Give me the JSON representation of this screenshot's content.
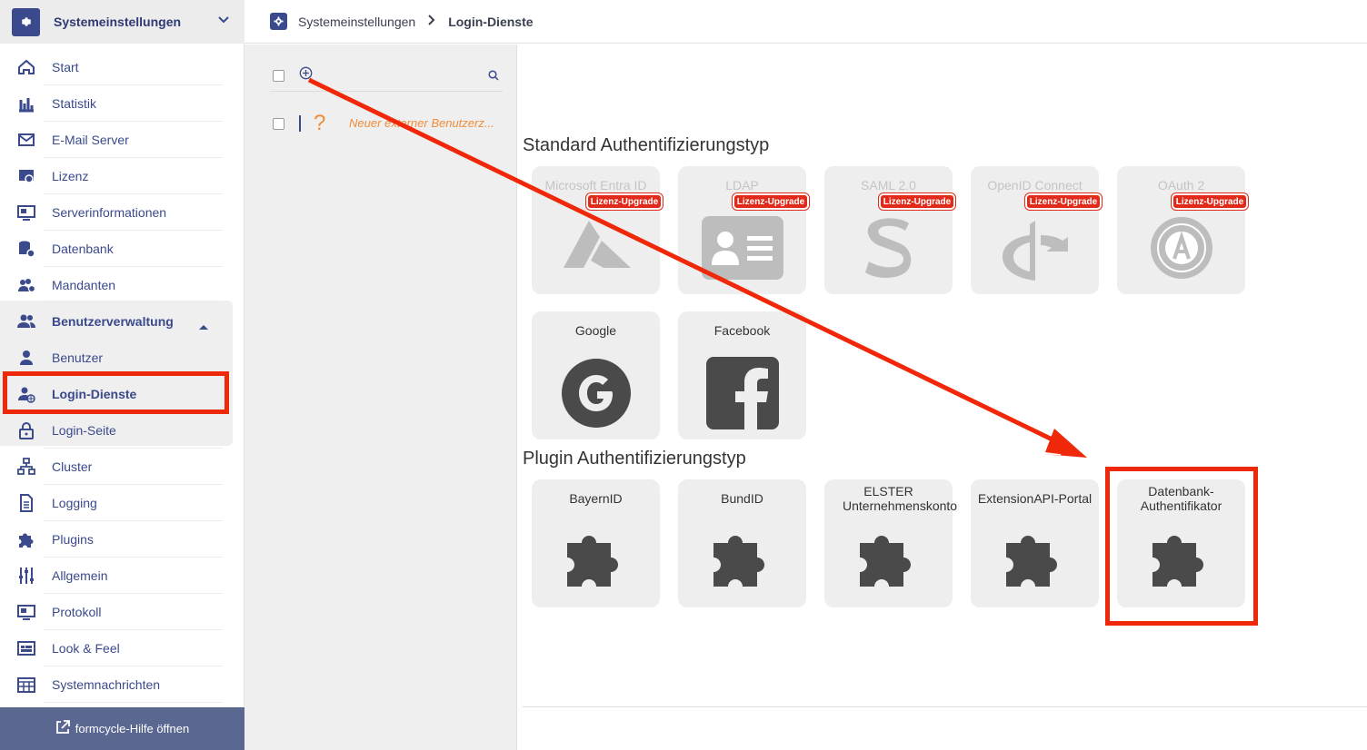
{
  "sidebar": {
    "header_title": "Systemeinstellungen",
    "items": [
      {
        "label": "Start",
        "icon": "home-icon"
      },
      {
        "label": "Statistik",
        "icon": "chart-icon"
      },
      {
        "label": "E-Mail Server",
        "icon": "mail-icon"
      },
      {
        "label": "Lizenz",
        "icon": "license-icon"
      },
      {
        "label": "Serverinformationen",
        "icon": "server-icon"
      },
      {
        "label": "Datenbank",
        "icon": "database-icon"
      },
      {
        "label": "Mandanten",
        "icon": "clients-icon"
      },
      {
        "label": "Benutzerverwaltung",
        "icon": "users-icon"
      },
      {
        "label": "Benutzer",
        "icon": "user-icon"
      },
      {
        "label": "Login-Dienste",
        "icon": "user-globe-icon"
      },
      {
        "label": "Login-Seite",
        "icon": "lock-icon"
      },
      {
        "label": "Cluster",
        "icon": "cluster-icon"
      },
      {
        "label": "Logging",
        "icon": "document-icon"
      },
      {
        "label": "Plugins",
        "icon": "puzzle-icon"
      },
      {
        "label": "Allgemein",
        "icon": "sliders-icon"
      },
      {
        "label": "Protokoll",
        "icon": "monitor-icon"
      },
      {
        "label": "Look & Feel",
        "icon": "layout-icon"
      },
      {
        "label": "Systemnachrichten",
        "icon": "calendar-icon"
      }
    ],
    "footer_label": "formcycle-Hilfe öffnen"
  },
  "breadcrumb": {
    "root": "Systemeinstellungen",
    "current": "Login-Dienste"
  },
  "list": {
    "rows": [
      {
        "label": "Neuer externer Benutzerz..."
      }
    ]
  },
  "main": {
    "standard_title": "Standard Authentifizierungstyp",
    "plugin_title": "Plugin Authentifizierungstyp",
    "badge_label": "Lizenz-Upgrade",
    "standard_tiles": [
      {
        "name": "Microsoft Entra ID",
        "icon": "azure-icon",
        "licensed": false
      },
      {
        "name": "LDAP",
        "icon": "id-card-icon",
        "licensed": false
      },
      {
        "name": "SAML 2.0",
        "icon": "saml-icon",
        "licensed": false
      },
      {
        "name": "OpenID Connect",
        "icon": "openid-icon",
        "licensed": false
      },
      {
        "name": "OAuth 2",
        "icon": "oauth-icon",
        "licensed": false
      },
      {
        "name": "Google",
        "icon": "google-icon",
        "licensed": true
      },
      {
        "name": "Facebook",
        "icon": "facebook-icon",
        "licensed": true
      }
    ],
    "plugin_tiles": [
      {
        "name": "BayernID",
        "icon": "puzzle-icon"
      },
      {
        "name": "BundID",
        "icon": "puzzle-icon"
      },
      {
        "name": "ELSTER Unternehmenskonto",
        "icon": "puzzle-icon"
      },
      {
        "name": "ExtensionAPI-Portal",
        "icon": "puzzle-icon"
      },
      {
        "name": "Datenbank-Authentifikator",
        "icon": "puzzle-icon"
      }
    ]
  },
  "colors": {
    "accent": "#3a4a8c",
    "highlight": "#f0280a",
    "badge": "#e22a1a",
    "list_item": "#f08c3a"
  }
}
